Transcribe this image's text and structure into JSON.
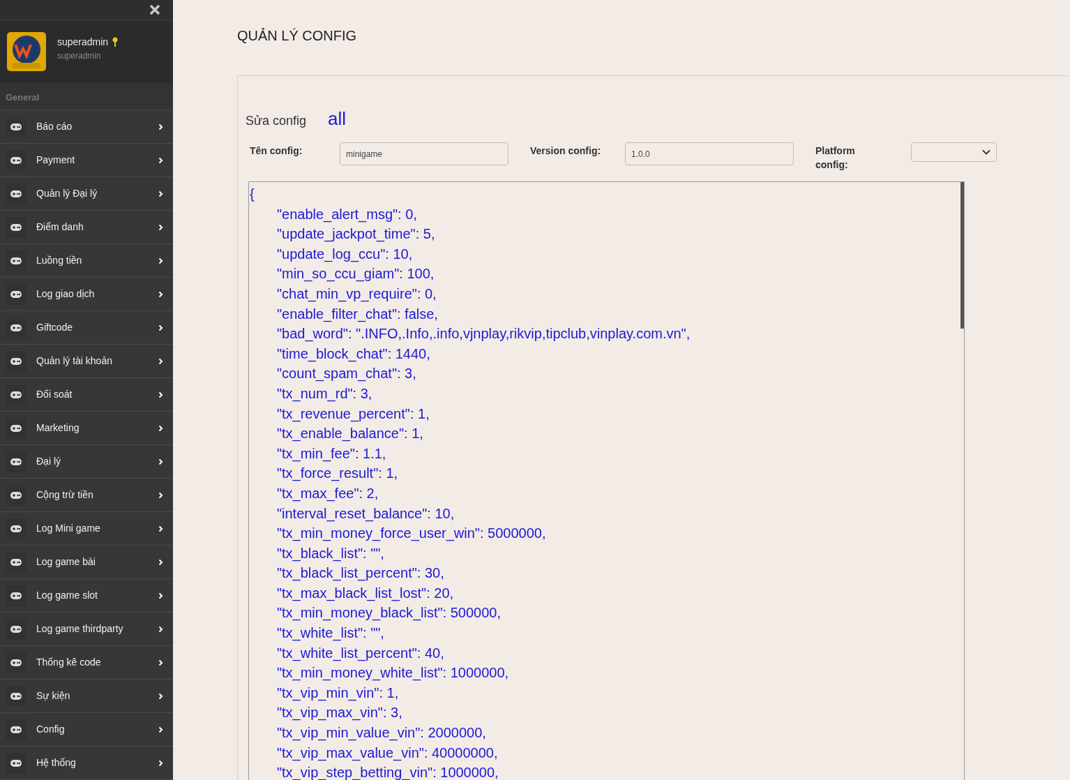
{
  "sidebar": {
    "user": {
      "name": "superadmin",
      "role": "superadmin"
    },
    "section": "General",
    "items": [
      {
        "label": "Báo cáo"
      },
      {
        "label": "Payment"
      },
      {
        "label": "Quản lý Đại lý"
      },
      {
        "label": "Điểm danh"
      },
      {
        "label": "Luồng tiền"
      },
      {
        "label": "Log giao dịch"
      },
      {
        "label": "Giftcode"
      },
      {
        "label": "Quản lý tài khoản"
      },
      {
        "label": "Đối soát"
      },
      {
        "label": "Marketing"
      },
      {
        "label": "Đại lý"
      },
      {
        "label": "Cộng trừ tiền"
      },
      {
        "label": "Log Mini game"
      },
      {
        "label": "Log game bài"
      },
      {
        "label": "Log game slot"
      },
      {
        "label": "Log game thirdparty"
      },
      {
        "label": "Thống kê code"
      },
      {
        "label": "Sự kiện"
      },
      {
        "label": "Config"
      },
      {
        "label": "Hệ thống"
      }
    ]
  },
  "page_title": "QUẢN LÝ CONFIG",
  "editor_heading": {
    "label": "Sửa config",
    "value": "all"
  },
  "form": {
    "name": {
      "label": "Tên config:",
      "value": "minigame"
    },
    "version": {
      "label": "Version config:",
      "value": "1.0.0"
    },
    "platform": {
      "label": "Platform config:"
    }
  },
  "config_lines": [
    "{",
    "\t\"enable_alert_msg\": 0,",
    "\t\"update_jackpot_time\": 5,",
    "\t\"update_log_ccu\": 10,",
    "\t\"min_so_ccu_giam\": 100,",
    "\t\"chat_min_vp_require\": 0,",
    "\t\"enable_filter_chat\": false,",
    "\t\"bad_word\": \".INFO,.Info,.info,vjnplay,rikvip,tipclub,vinplay.com.vn\",",
    "\t\"time_block_chat\": 1440,",
    "\t\"count_spam_chat\": 3,",
    "\t\"tx_num_rd\": 3,",
    "\t\"tx_revenue_percent\": 1,",
    "\t\"tx_enable_balance\": 1,",
    "\t\"tx_min_fee\": 1.1,",
    "\t\"tx_force_result\": 1,",
    "\t\"tx_max_fee\": 2,",
    "\t\"interval_reset_balance\": 10,",
    "\t\"tx_min_money_force_user_win\": 5000000,",
    "\t\"tx_black_list\": \"\",",
    "\t\"tx_black_list_percent\": 30,",
    "\t\"tx_max_black_list_lost\": 20,",
    "\t\"tx_min_money_black_list\": 500000,",
    "\t\"tx_white_list\": \"\",",
    "\t\"tx_white_list_percent\": 40,",
    "\t\"tx_min_money_white_list\": 1000000,",
    "\t\"tx_vip_min_vin\": 1,",
    "\t\"tx_vip_max_vin\": 3,",
    "\t\"tx_vip_min_value_vin\": 2000000,",
    "\t\"tx_vip_max_value_vin\": 40000000,",
    "\t\"tx_vip_step_betting_vin\": 1000000,"
  ]
}
